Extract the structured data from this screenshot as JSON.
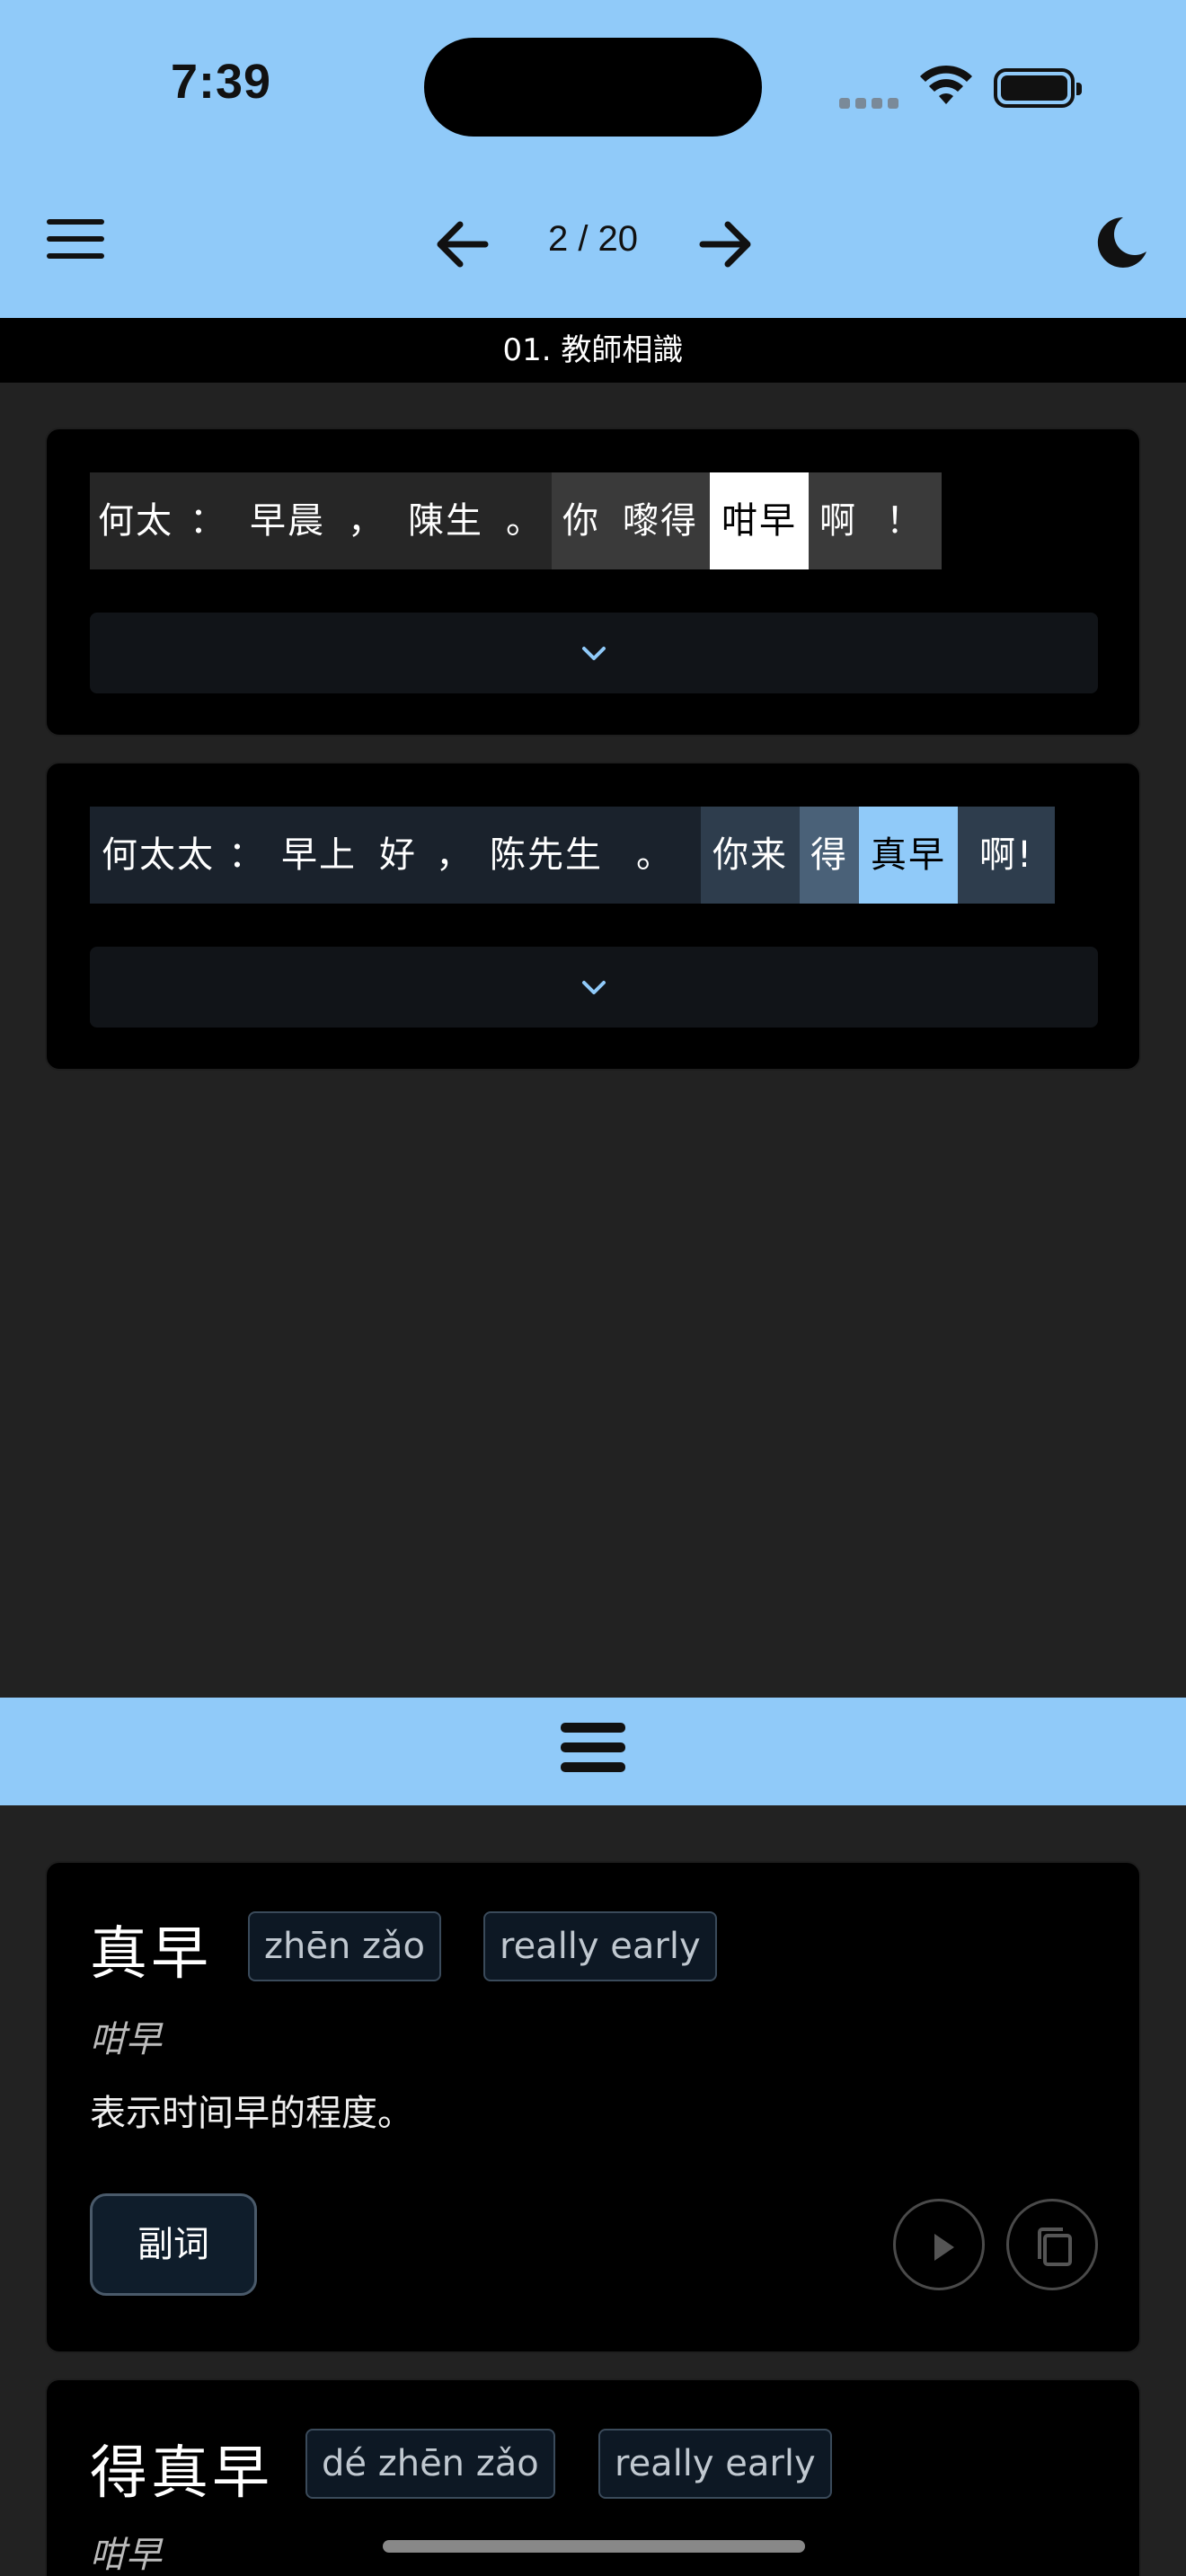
{
  "status_bar": {
    "time": "7:39"
  },
  "toolbar": {
    "page_counter": "2 / 20"
  },
  "lesson": {
    "title": "01. 教師相識"
  },
  "sentences": [
    {
      "tokens": [
        {
          "text": "何太",
          "bg": "#262626",
          "fg": "#ffffff",
          "w": 102
        },
        {
          "text": "：",
          "bg": "#262626",
          "fg": "#ffffff",
          "w": 60
        },
        {
          "text": "早晨",
          "bg": "#262626",
          "fg": "#ffffff",
          "w": 116
        },
        {
          "text": "，",
          "bg": "#262626",
          "fg": "#ffffff",
          "w": 60
        },
        {
          "text": "陳生",
          "bg": "#262626",
          "fg": "#ffffff",
          "w": 116
        },
        {
          "text": "。",
          "bg": "#262626",
          "fg": "#ffffff",
          "w": 60
        },
        {
          "text": "你",
          "bg": "#3a3a3a",
          "fg": "#ffffff",
          "w": 66
        },
        {
          "text": "嚟得",
          "bg": "#3a3a3a",
          "fg": "#ffffff",
          "w": 110
        },
        {
          "text": "咁早",
          "bg": "#ffffff",
          "fg": "#000000",
          "w": 110
        },
        {
          "text": "啊",
          "bg": "#3a3a3a",
          "fg": "#ffffff",
          "w": 66
        },
        {
          "text": "！",
          "bg": "#3a3a3a",
          "fg": "#ffffff",
          "w": 82
        }
      ]
    },
    {
      "tokens": [
        {
          "text": "何太太",
          "bg": "#1a222c",
          "fg": "#ffffff",
          "w": 152
        },
        {
          "text": "：",
          "bg": "#1a222c",
          "fg": "#ffffff",
          "w": 46
        },
        {
          "text": "早上",
          "bg": "#1a222c",
          "fg": "#ffffff",
          "w": 114
        },
        {
          "text": "好",
          "bg": "#1a222c",
          "fg": "#ffffff",
          "w": 62
        },
        {
          "text": "，",
          "bg": "#1a222c",
          "fg": "#ffffff",
          "w": 64
        },
        {
          "text": "陈先生",
          "bg": "#1a222c",
          "fg": "#ffffff",
          "w": 140
        },
        {
          "text": "。",
          "bg": "#1a222c",
          "fg": "#ffffff",
          "w": 102
        },
        {
          "text": "你来",
          "bg": "#2e3d4d",
          "fg": "#ffffff",
          "w": 110
        },
        {
          "text": "得",
          "bg": "#4a6178",
          "fg": "#ffffff",
          "w": 66
        },
        {
          "text": "真早",
          "bg": "#90caf9",
          "fg": "#000000",
          "w": 110
        },
        {
          "text": "啊!",
          "bg": "#2e3d4d",
          "fg": "#ffffff",
          "w": 108
        }
      ]
    }
  ],
  "words": [
    {
      "headword": "真早",
      "pinyin": "zhēn zǎo",
      "gloss": "really early",
      "traditional": "咁早",
      "definition": "表示时间早的程度。",
      "part_of_speech": "副词"
    },
    {
      "headword": "得真早",
      "pinyin": "dé zhēn zǎo",
      "gloss": "really early",
      "traditional": "咁早"
    }
  ],
  "colors": {
    "accent": "#90caf9",
    "background": "#222222",
    "card": "#000000"
  },
  "icons": {
    "menu": "hamburger-menu-icon",
    "prev": "arrow-left-icon",
    "next": "arrow-right-icon",
    "theme": "moon-icon",
    "expand": "chevron-down-icon",
    "play": "play-icon",
    "copy": "copy-icon"
  }
}
